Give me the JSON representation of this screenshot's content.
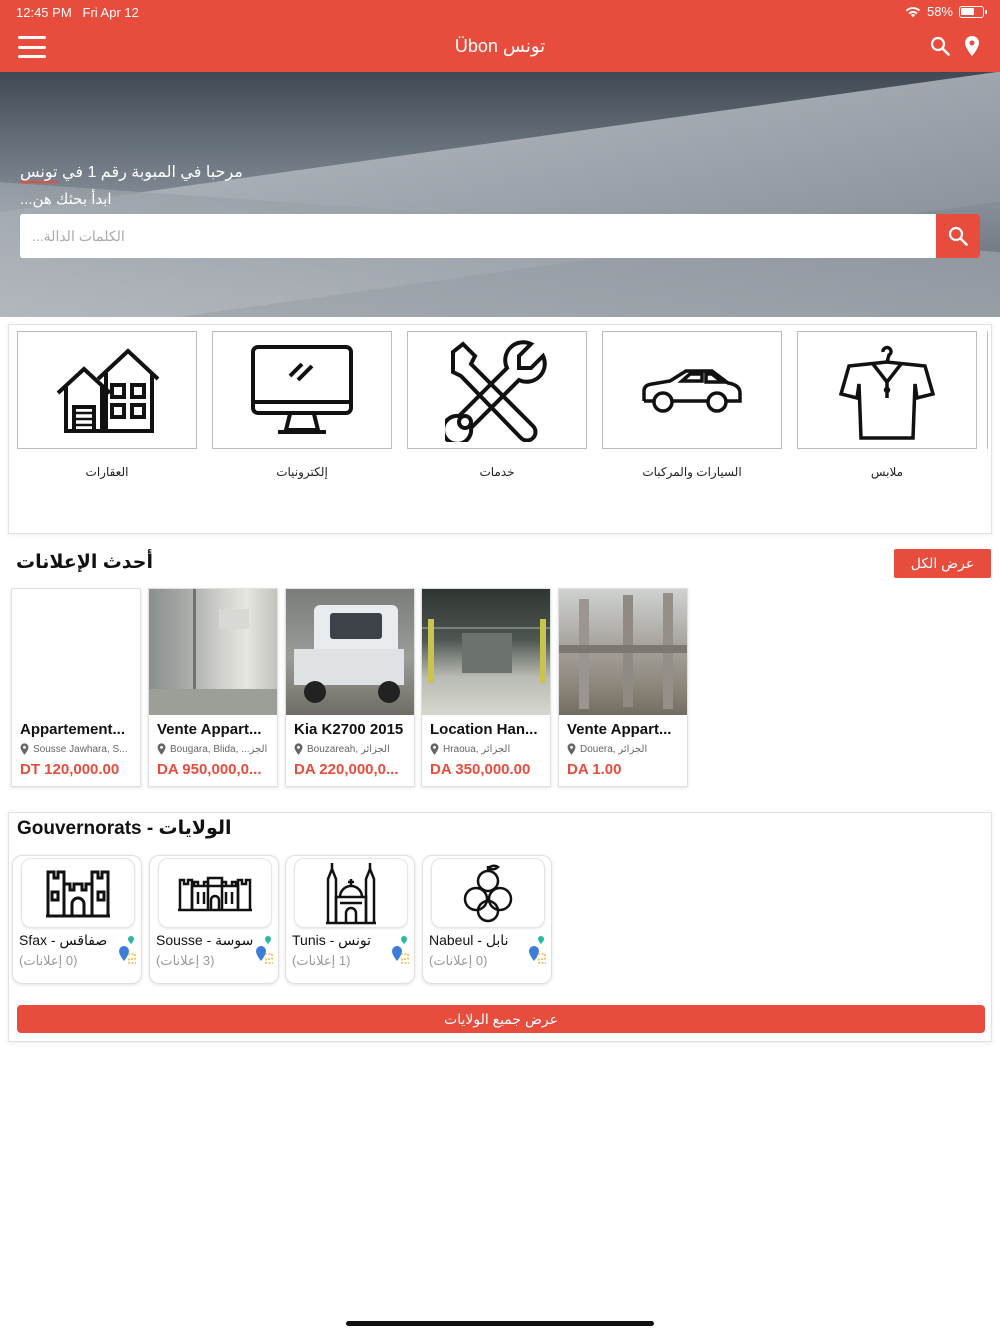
{
  "status": {
    "time": "12:45 PM",
    "date": "Fri Apr 12",
    "battery": "58%"
  },
  "header": {
    "title": "Übon تونس"
  },
  "hero": {
    "welcome_prefix": "مرحبا في المبوبة رقم 1 في ",
    "welcome_highlight": "تونس",
    "subtitle": "ابدأ بحثك هن...",
    "search_placeholder": "الكلمات الدالة..."
  },
  "categories": [
    {
      "label": "العقارات",
      "icon": "house-icon"
    },
    {
      "label": "إلكترونيات",
      "icon": "monitor-icon"
    },
    {
      "label": "خدمات",
      "icon": "tools-icon"
    },
    {
      "label": "السيارات والمركبات",
      "icon": "car-icon"
    },
    {
      "label": "ملابس",
      "icon": "shirt-icon"
    }
  ],
  "latest": {
    "title": "أحدث الإعلانات",
    "view_all": "عرض الكل",
    "ads": [
      {
        "title": "Appartement...",
        "location": "Sousse Jawhara, S...",
        "price": "DT 120,000.00"
      },
      {
        "title": "Vente Appart...",
        "location": "Bougara, Blida, ...الجز",
        "price": "DA 950,000,0..."
      },
      {
        "title": "Kia K2700 2015",
        "location": "Bouzareah, الجزائر",
        "price": "DA 220,000,0..."
      },
      {
        "title": "Location Han...",
        "location": "Hraoua, الجزائر",
        "price": "DA 350,000.00"
      },
      {
        "title": "Vente Appart...",
        "location": "Douera, الجزائر",
        "price": "DA 1.00"
      }
    ]
  },
  "governorates": {
    "title": "Gouvernorats - الولايات",
    "items": [
      {
        "name": "Sfax - صفاقس",
        "count": "(0 إعلانات)"
      },
      {
        "name": "Sousse - سوسة",
        "count": "(3 إعلانات)"
      },
      {
        "name": "Tunis - تونس",
        "count": "(1 إعلانات)"
      },
      {
        "name": "Nabeul - نابل",
        "count": "(0 إعلانات)"
      }
    ],
    "view_all": "عرض جميع الولايات"
  },
  "colors": {
    "accent": "#e84c3d"
  }
}
